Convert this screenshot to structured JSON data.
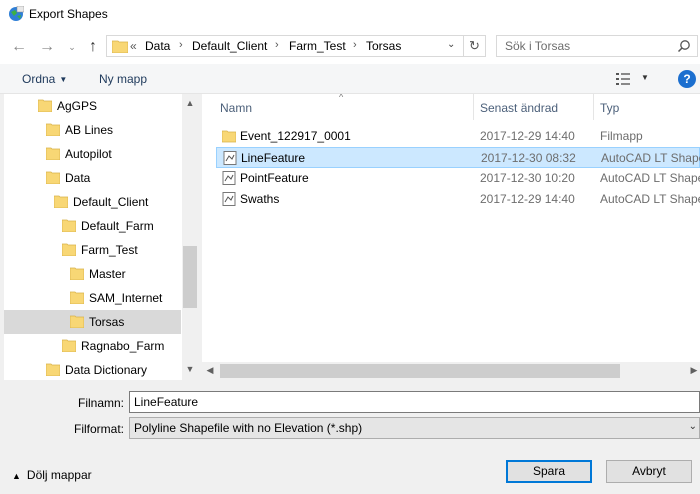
{
  "window": {
    "title": "Export Shapes",
    "icon": "globe-app-icon"
  },
  "nav": {
    "back_icon": "back-arrow-icon",
    "forward_icon": "forward-arrow-icon",
    "recent_icon": "chevron-down-icon",
    "up_icon": "up-arrow-icon"
  },
  "address": {
    "overflow": "«",
    "crumbs": [
      "Data",
      "Default_Client",
      "Farm_Test",
      "Torsas"
    ],
    "separator": "›"
  },
  "search": {
    "placeholder": "Sök i Torsas"
  },
  "toolbar": {
    "organize_label": "Ordna",
    "new_folder_label": "Ny mapp",
    "help_label": "?"
  },
  "tree": {
    "items": [
      {
        "label": "AgGPS",
        "level": 0
      },
      {
        "label": "AB Lines",
        "level": 1
      },
      {
        "label": "Autopilot",
        "level": 1
      },
      {
        "label": "Data",
        "level": 1
      },
      {
        "label": "Default_Client",
        "level": 2
      },
      {
        "label": "Default_Farm",
        "level": 3
      },
      {
        "label": "Farm_Test",
        "level": 3
      },
      {
        "label": "Master",
        "level": 4
      },
      {
        "label": "SAM_Internet",
        "level": 4
      },
      {
        "label": "Torsas",
        "level": 4,
        "selected": true
      },
      {
        "label": "Ragnabo_Farm",
        "level": 3
      },
      {
        "label": "Data Dictionary",
        "level": 1
      }
    ]
  },
  "files": {
    "columns": {
      "name": "Namn",
      "modified": "Senast ändrad",
      "type": "Typ"
    },
    "rows": [
      {
        "name": "Event_122917_0001",
        "modified": "2017-12-29 14:40",
        "type": "Filmapp",
        "icon": "folder-icon"
      },
      {
        "name": "LineFeature",
        "modified": "2017-12-30 08:32",
        "type": "AutoCAD LT Shape",
        "icon": "shape-file-icon",
        "selected": true
      },
      {
        "name": "PointFeature",
        "modified": "2017-12-30 10:20",
        "type": "AutoCAD LT Shape",
        "icon": "shape-file-icon"
      },
      {
        "name": "Swaths",
        "modified": "2017-12-29 14:40",
        "type": "AutoCAD LT Shape",
        "icon": "shape-file-icon"
      }
    ]
  },
  "form": {
    "filename_label": "Filnamn:",
    "filename_value": "LineFeature",
    "format_label": "Filformat:",
    "format_value": "Polyline Shapefile with no Elevation (*.shp)"
  },
  "footer": {
    "hide_folders_label": "Dölj mappar",
    "save_label": "Spara",
    "cancel_label": "Avbryt"
  },
  "colors": {
    "accent": "#0078d7",
    "selection": "#cce8ff",
    "folder": "#f8d775"
  }
}
